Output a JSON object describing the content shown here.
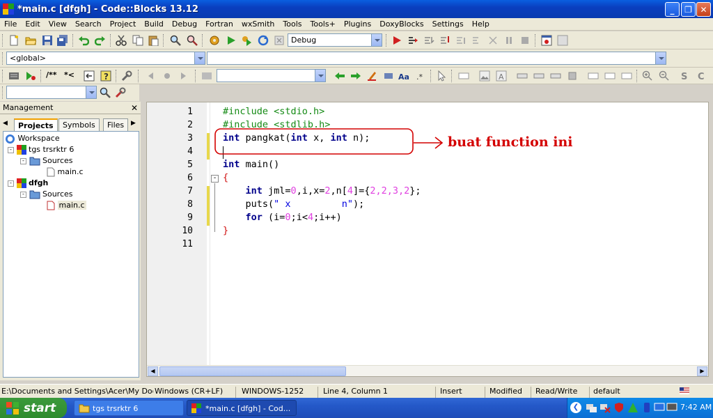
{
  "window": {
    "title": "*main.c [dfgh] - Code::Blocks 13.12",
    "min_label": "_",
    "max_label": "❐",
    "close_label": "✕"
  },
  "menu": [
    "File",
    "Edit",
    "View",
    "Search",
    "Project",
    "Build",
    "Debug",
    "Fortran",
    "wxSmith",
    "Tools",
    "Tools+",
    "Plugins",
    "DoxyBlocks",
    "Settings",
    "Help"
  ],
  "toolbar": {
    "build_target": "Debug",
    "scope": "<global>",
    "search_value": "",
    "comment_labels": [
      "/**",
      "*<"
    ]
  },
  "management": {
    "title": "Management",
    "close_label": "✕",
    "tabs": [
      "Projects",
      "Symbols",
      "Files"
    ],
    "tree": {
      "workspace": "Workspace",
      "project1": "tgs trsrktr 6",
      "sources1": "Sources",
      "file1": "main.c",
      "project2": "dfgh",
      "sources2": "Sources",
      "file2": "main.c"
    }
  },
  "editor": {
    "line_numbers": [
      "1",
      "2",
      "3",
      "4",
      "5",
      "6",
      "7",
      "8",
      "9",
      "10",
      "11"
    ],
    "lines": {
      "l1": "#include <stdio.h>",
      "l2": "#include <stdlib.h>",
      "l3a": "int",
      "l3b": " pangkat(",
      "l3c": "int",
      "l3d": " x, ",
      "l3e": "int",
      "l3f": " n);",
      "l5a": "int",
      "l5b": " main()",
      "l6": "{",
      "l7a": "    int",
      "l7b": " jml=",
      "l7c": "0",
      "l7d": ",i,x=",
      "l7e": "2",
      "l7f": ",n[",
      "l7g": "4",
      "l7h": "]={",
      "l7i": "2,2,3,2",
      "l7j": "};",
      "l8a": "    puts(",
      "l8b": "\" x         n\"",
      "l8c": ");",
      "l9a": "    for",
      "l9b": " (i=",
      "l9c": "0",
      "l9d": ";i<",
      "l9e": "4",
      "l9f": ";i++)",
      "l10": "}"
    },
    "annotation": "buat function ini"
  },
  "status": {
    "path": "E:\\Documents and Settings\\Acer\\My Documei",
    "eol": "Windows (CR+LF)",
    "encoding": "WINDOWS-1252",
    "position": "Line 4, Column 1",
    "mode": "Insert",
    "modified": "Modified",
    "access": "Read/Write",
    "lang": "default"
  },
  "taskbar": {
    "start": "start",
    "tasks": [
      "tgs trsrktr 6",
      "*main.c [dfgh] - Cod..."
    ],
    "clock": "7:42 AM"
  },
  "colors": {
    "titlebar": "#0a3fbf",
    "keyword": "#00008b",
    "preprocessor": "#148a14",
    "number": "#e040e0",
    "annotation": "#d40000"
  }
}
